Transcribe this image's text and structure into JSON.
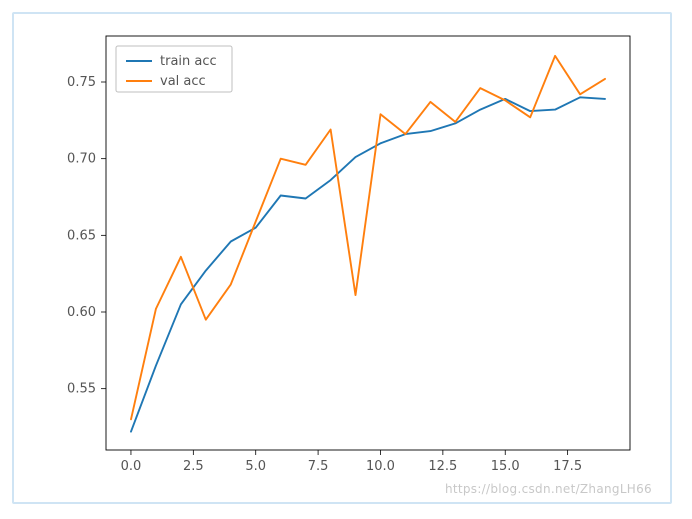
{
  "chart_data": {
    "type": "line",
    "x": [
      0,
      1,
      2,
      3,
      4,
      5,
      6,
      7,
      8,
      9,
      10,
      11,
      12,
      13,
      14,
      15,
      16,
      17,
      18,
      19
    ],
    "series": [
      {
        "name": "train acc",
        "color": "#1f77b4",
        "values": [
          0.522,
          0.565,
          0.605,
          0.627,
          0.646,
          0.655,
          0.676,
          0.674,
          0.686,
          0.701,
          0.71,
          0.716,
          0.718,
          0.723,
          0.732,
          0.739,
          0.731,
          0.732,
          0.74,
          0.739
        ]
      },
      {
        "name": "val acc",
        "color": "#ff7f0e",
        "values": [
          0.53,
          0.602,
          0.636,
          0.595,
          0.618,
          0.659,
          0.7,
          0.696,
          0.719,
          0.611,
          0.729,
          0.716,
          0.737,
          0.724,
          0.746,
          0.738,
          0.727,
          0.767,
          0.742,
          0.752
        ]
      }
    ],
    "title": "",
    "xlabel": "",
    "ylabel": "",
    "xlim": [
      -1,
      20
    ],
    "ylim": [
      0.51,
      0.78
    ],
    "xticks": [
      0.0,
      2.5,
      5.0,
      7.5,
      10.0,
      12.5,
      15.0,
      17.5
    ],
    "yticks": [
      0.55,
      0.6,
      0.65,
      0.7,
      0.75
    ],
    "legend": {
      "position": "upper left",
      "labels": [
        "train acc",
        "val acc"
      ]
    }
  },
  "watermark": "https://blog.csdn.net/ZhangLH66"
}
